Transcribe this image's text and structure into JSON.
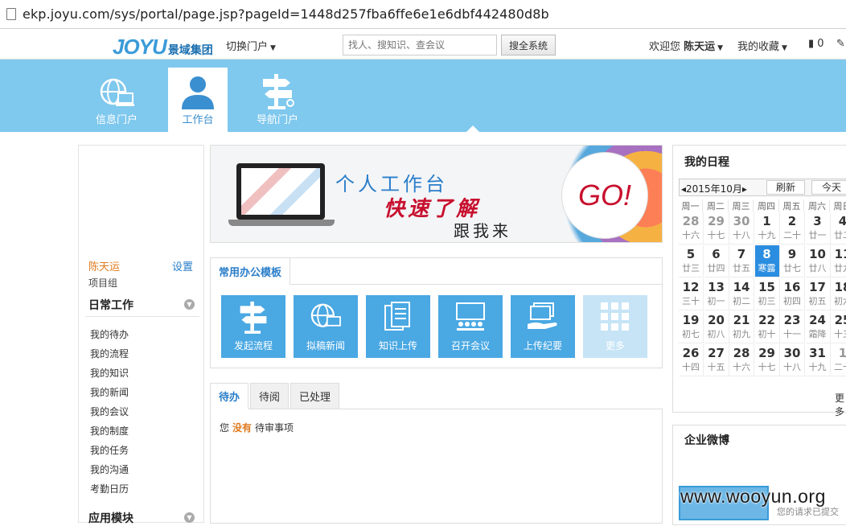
{
  "browser": {
    "url": "ekp.joyu.com/sys/portal/page.jsp?pageId=1448d257fba6ffe6e1e6dbf442480d8b"
  },
  "header": {
    "logo_en": "JOYU",
    "logo_cn": "景域集团",
    "switch_portal": "切换门户",
    "search_placeholder": "找人、搜知识、查会议",
    "search_button": "搜全系统",
    "welcome_prefix": "欢迎您",
    "username": "陈天运",
    "favorites": "我的收藏",
    "doc_count": "0"
  },
  "portals": [
    {
      "label": "信息门户",
      "icon": "globe-laptop-icon",
      "active": false
    },
    {
      "label": "工作台",
      "icon": "user-icon",
      "active": true
    },
    {
      "label": "导航门户",
      "icon": "signpost-icon",
      "active": false
    }
  ],
  "left": {
    "user": "陈天运",
    "settings": "设置",
    "group": "项目组",
    "daily_title": "日常工作",
    "daily_items": [
      "我的待办",
      "我的流程",
      "我的知识",
      "我的新闻",
      "我的会议",
      "我的制度",
      "我的任务",
      "我的沟通",
      "考勤日历"
    ],
    "apps_title": "应用模块"
  },
  "promo": {
    "line1": "个人工作台",
    "line2": "快速了解",
    "line3": "跟我来",
    "go": "GO!"
  },
  "templates": {
    "title": "常用办公模板",
    "tiles": [
      {
        "label": "发起流程",
        "icon": "signpost-icon"
      },
      {
        "label": "拟稿新闻",
        "icon": "globe-laptop-icon"
      },
      {
        "label": "知识上传",
        "icon": "document-icon"
      },
      {
        "label": "召开会议",
        "icon": "meeting-icon"
      },
      {
        "label": "上传纪要",
        "icon": "upload-hand-icon"
      },
      {
        "label": "更多",
        "icon": "grid-icon"
      }
    ]
  },
  "todo": {
    "tabs": [
      "待办",
      "待阅",
      "已处理"
    ],
    "msg_prefix": "您",
    "msg_highlight": "没有",
    "msg_suffix": "待审事项"
  },
  "schedule": {
    "title": "我的日程",
    "month": "2015年10月",
    "refresh": "刷新",
    "today": "今天",
    "weekdays": [
      "周一",
      "周二",
      "周三",
      "周四",
      "周五",
      "周六",
      "周日"
    ],
    "weeks": [
      [
        [
          "28",
          "十六",
          true
        ],
        [
          "29",
          "十七",
          true
        ],
        [
          "30",
          "十八",
          true
        ],
        [
          "1",
          "十九",
          false
        ],
        [
          "2",
          "二十",
          false
        ],
        [
          "3",
          "廿一",
          false
        ],
        [
          "4",
          "廿二",
          false
        ]
      ],
      [
        [
          "5",
          "廿三",
          false
        ],
        [
          "6",
          "廿四",
          false
        ],
        [
          "7",
          "廿五",
          false
        ],
        [
          "8",
          "寒露",
          false
        ],
        [
          "9",
          "廿七",
          false
        ],
        [
          "10",
          "廿八",
          false
        ],
        [
          "11",
          "廿九",
          false
        ]
      ],
      [
        [
          "12",
          "三十",
          false
        ],
        [
          "13",
          "初一",
          false
        ],
        [
          "14",
          "初二",
          false
        ],
        [
          "15",
          "初三",
          false
        ],
        [
          "16",
          "初四",
          false
        ],
        [
          "17",
          "初五",
          false
        ],
        [
          "18",
          "初六",
          false
        ]
      ],
      [
        [
          "19",
          "初七",
          false
        ],
        [
          "20",
          "初八",
          false
        ],
        [
          "21",
          "初九",
          false
        ],
        [
          "22",
          "初十",
          false
        ],
        [
          "23",
          "十一",
          false
        ],
        [
          "24",
          "霜降",
          false
        ],
        [
          "25",
          "十三",
          false
        ]
      ],
      [
        [
          "26",
          "十四",
          false
        ],
        [
          "27",
          "十五",
          false
        ],
        [
          "28",
          "十六",
          false
        ],
        [
          "29",
          "十七",
          false
        ],
        [
          "30",
          "十八",
          false
        ],
        [
          "31",
          "十九",
          false
        ],
        [
          "1",
          "二十",
          true
        ]
      ]
    ],
    "today_date": "8",
    "more": "更多"
  },
  "weibo": {
    "title": "企业微博",
    "text": "您的请求已提交"
  },
  "watermark": "www.wooyun.org",
  "colors": {
    "banner": "#7fc8ee",
    "tile": "#4aa8e3",
    "accent": "#2a7ec9",
    "highlight": "#e07a1f"
  }
}
